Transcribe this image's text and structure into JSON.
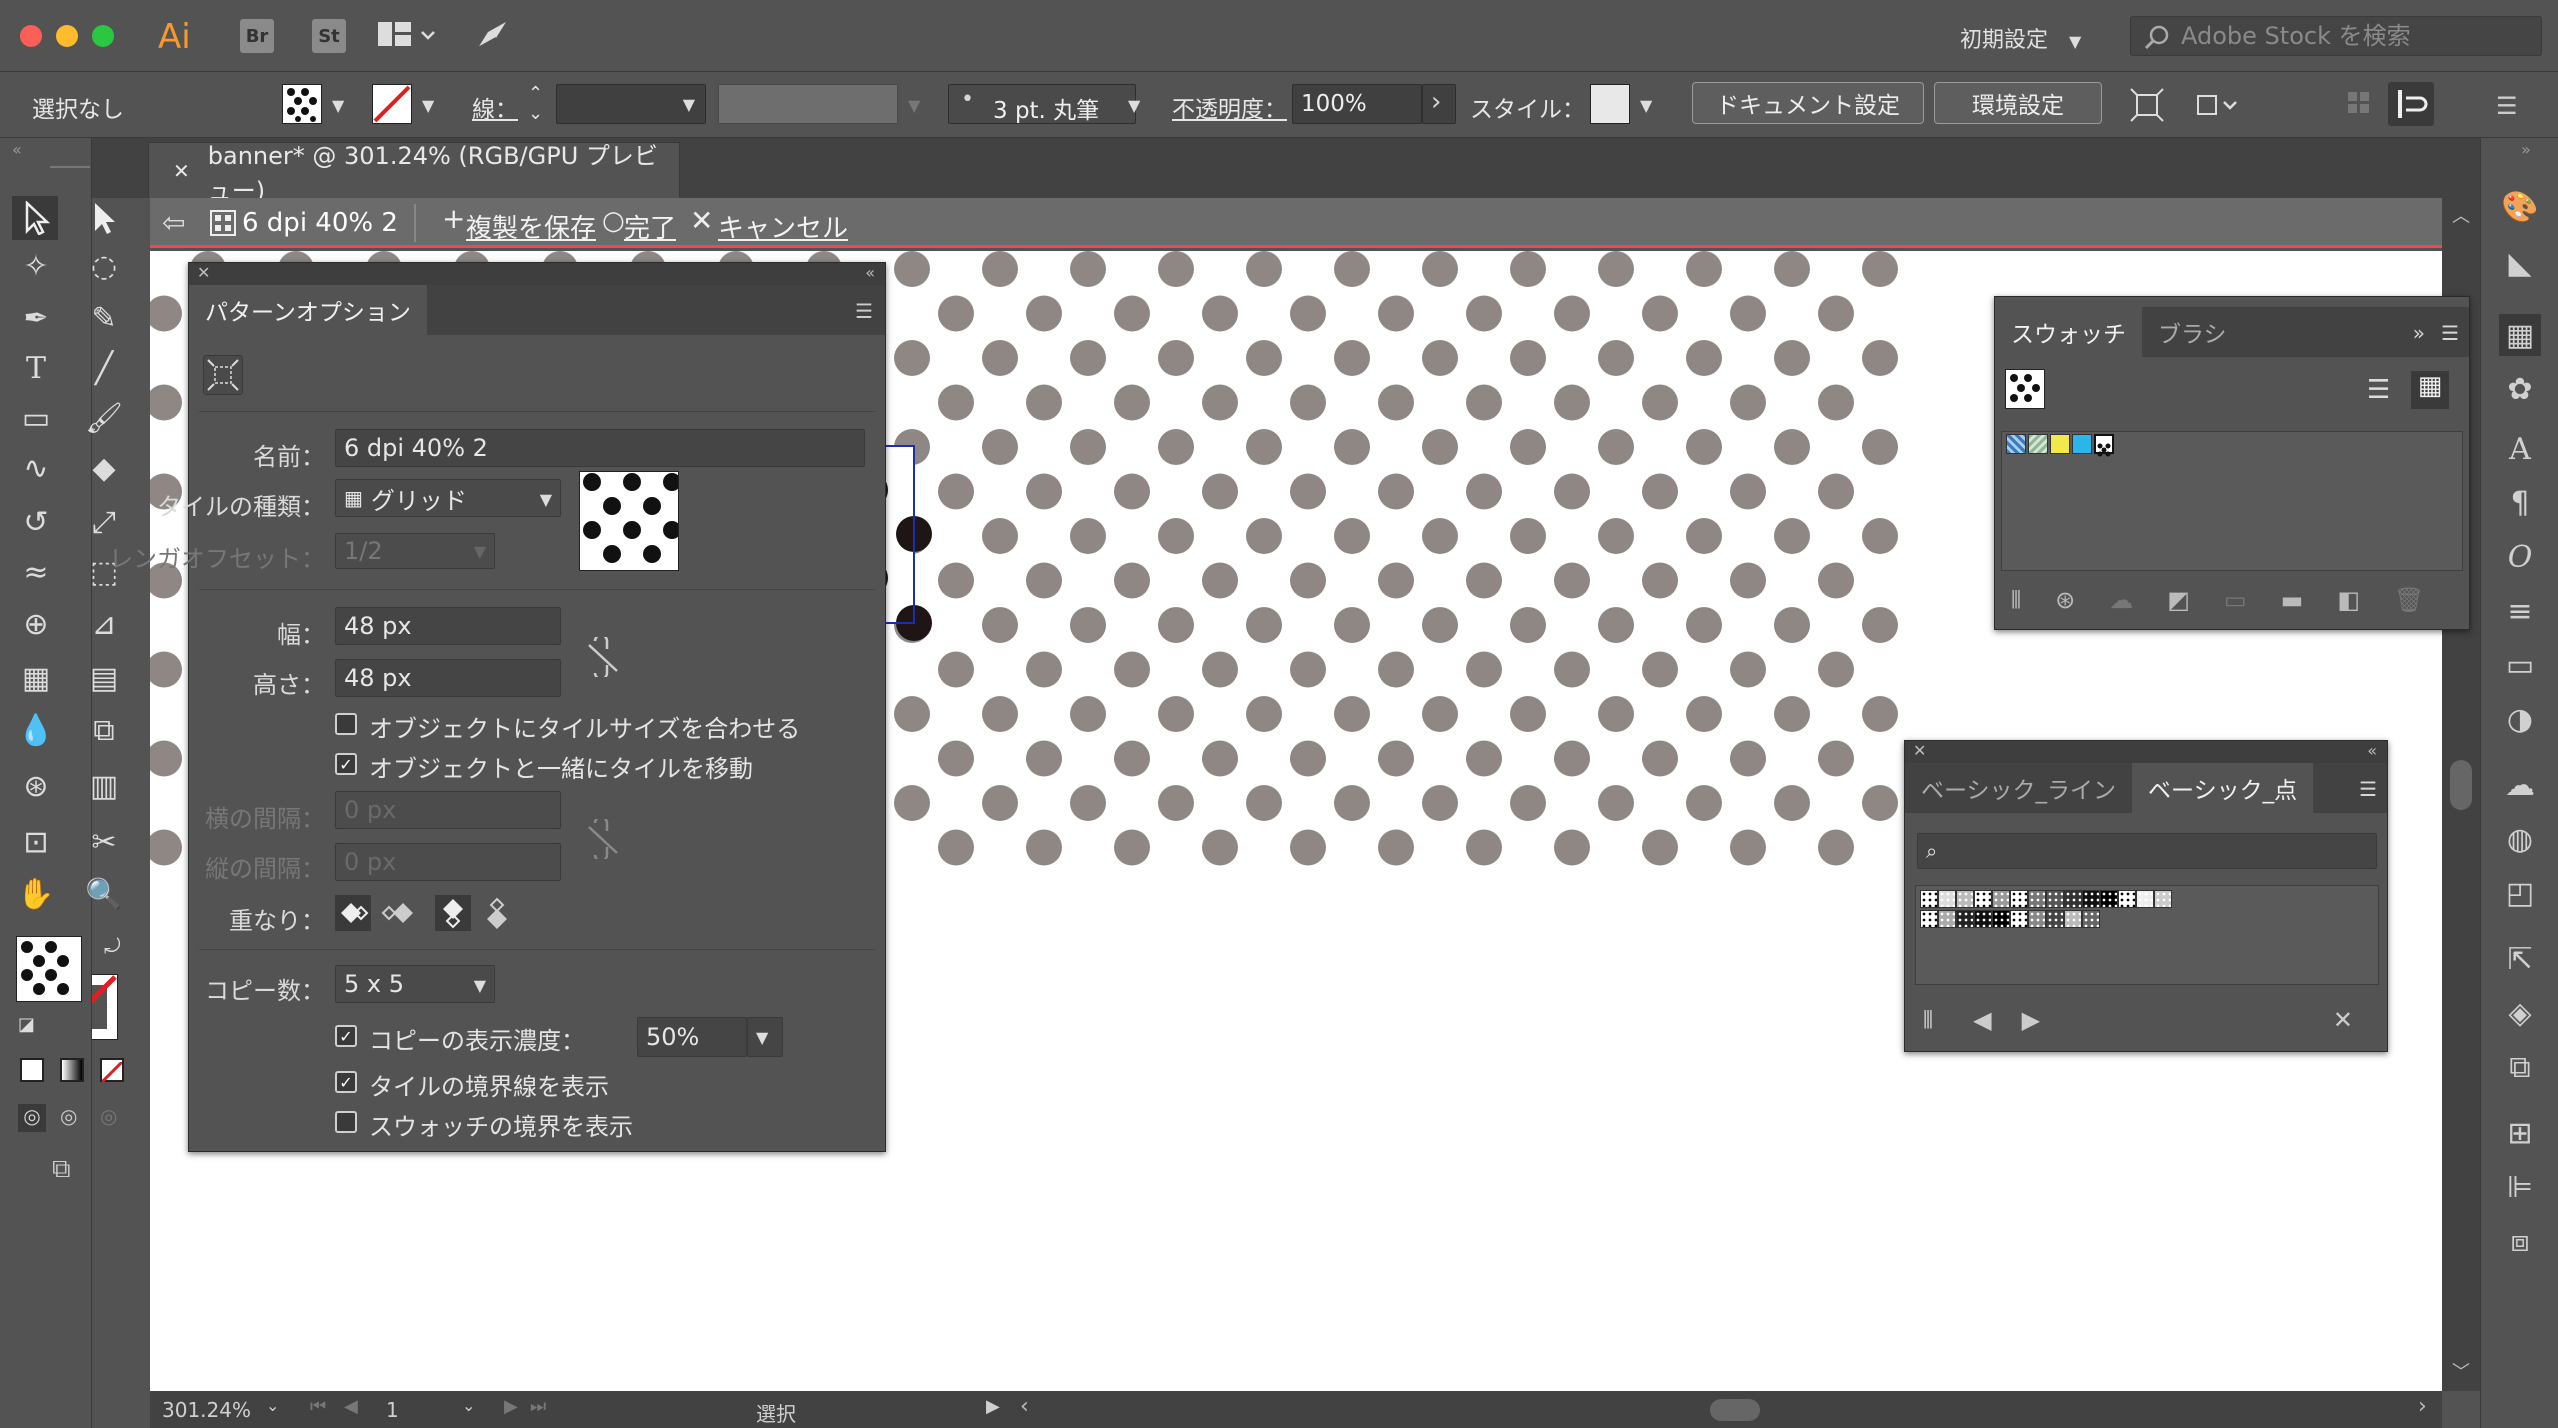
{
  "app": {
    "logo": "Ai",
    "bridge": "Br",
    "stock": "St"
  },
  "workspace": {
    "label": "初期設定"
  },
  "stock_search": {
    "placeholder": "Adobe Stock を検索"
  },
  "control": {
    "selection": "選択なし",
    "stroke_label": "線：",
    "brush": "3 pt. 丸筆",
    "opacity_label": "不透明度：",
    "opacity_value": "100%",
    "style_label": "スタイル：",
    "doc_settings": "ドキュメント設定",
    "prefs": "環境設定"
  },
  "document": {
    "tab_title": "banner* @ 301.24% (RGB/GPU プレビュー)"
  },
  "isolation": {
    "pattern_name": "6 dpi 40% 2",
    "save_copy": "複製を保存",
    "done": "完了",
    "cancel": "キャンセル"
  },
  "pattern_options": {
    "title": "パターンオプション",
    "name_label": "名前：",
    "name_value": "6 dpi 40% 2",
    "tile_type_label": "タイルの種類：",
    "tile_type_value": "グリッド",
    "brick_offset_label": "レンガオフセット：",
    "brick_offset_value": "1/2",
    "width_label": "幅：",
    "width_value": "48 px",
    "height_label": "高さ：",
    "height_value": "48 px",
    "fit_tile": "オブジェクトにタイルサイズを合わせる",
    "move_tile": "オブジェクトと一緒にタイルを移動",
    "h_spacing_label": "横の間隔：",
    "h_spacing_value": "0 px",
    "v_spacing_label": "縦の間隔：",
    "v_spacing_value": "0 px",
    "overlap_label": "重なり：",
    "copies_label": "コピー数：",
    "copies_value": "5 x 5",
    "dim_copies": "コピーの表示濃度：",
    "dim_value": "50%",
    "show_tile_edge": "タイルの境界線を表示",
    "show_swatch_bounds": "スウォッチの境界を表示",
    "fit_tile_checked": false,
    "move_tile_checked": true,
    "dim_checked": true,
    "tile_edge_checked": true,
    "swatch_bounds_checked": false
  },
  "swatches_panel": {
    "tab_swatches": "スウォッチ",
    "tab_brushes": "ブラシ"
  },
  "library_panel": {
    "tab_line": "ベーシック_ライン",
    "tab_dot": "ベーシック_点"
  },
  "status": {
    "zoom": "301.24%",
    "artboard": "1",
    "mode": "選択"
  },
  "colors": {
    "dot_gray": "#8e8784",
    "dot_black": "#1e1514",
    "tile_border": "#1a2eb0",
    "isolation_line": "#e05050"
  }
}
